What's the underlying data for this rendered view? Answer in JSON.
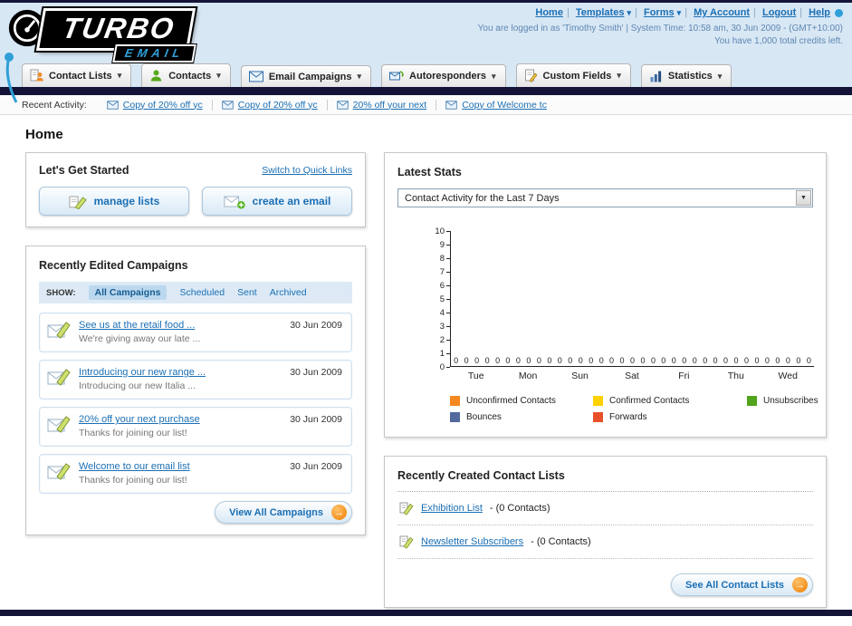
{
  "header": {
    "logo_text": "TURBO",
    "logo_sub": "EMAIL",
    "nav": [
      {
        "label": "Home"
      },
      {
        "label": "Templates"
      },
      {
        "label": "Forms"
      },
      {
        "label": "My Account"
      },
      {
        "label": "Logout"
      },
      {
        "label": "Help"
      }
    ],
    "login_info": "You are logged in as 'Timothy Smith' | System Time: 10:58 am, 30 Jun 2009 - (GMT+10:00)",
    "credits_info": "You have 1,000 total credits left."
  },
  "main_nav": {
    "items": [
      {
        "label": "Contact Lists"
      },
      {
        "label": "Contacts"
      },
      {
        "label": "Email Campaigns"
      },
      {
        "label": "Autoresponders"
      },
      {
        "label": "Custom Fields"
      },
      {
        "label": "Statistics"
      }
    ]
  },
  "recent_activity": {
    "label": "Recent Activity:",
    "items": [
      "Copy of 20% off yc",
      "Copy of 20% off yc",
      "20% off your next",
      "Copy of Welcome tc"
    ]
  },
  "page_title": "Home",
  "get_started": {
    "title": "Let's Get Started",
    "switch_link": "Switch to Quick Links",
    "manage_lists_label": "manage lists",
    "create_email_label": "create an email"
  },
  "campaigns": {
    "title": "Recently Edited Campaigns",
    "show_label": "SHOW:",
    "tabs": [
      "All Campaigns",
      "Scheduled",
      "Sent",
      "Archived"
    ],
    "selected_tab": "All Campaigns",
    "items": [
      {
        "title": "See us at the retail food ...",
        "subtitle": "We're giving away our late ...",
        "date": "30 Jun 2009"
      },
      {
        "title": "Introducing our new range ...",
        "subtitle": "Introducing our new Italia ...",
        "date": "30 Jun 2009"
      },
      {
        "title": "20% off your next purchase",
        "subtitle": "Thanks for joining our list!",
        "date": "30 Jun 2009"
      },
      {
        "title": "Welcome to our email list",
        "subtitle": "Thanks for joining our list!",
        "date": "30 Jun 2009"
      }
    ],
    "view_all_label": "View All Campaigns"
  },
  "latest_stats": {
    "title": "Latest Stats",
    "dropdown_value": "Contact Activity for the Last 7 Days"
  },
  "chart_data": {
    "type": "bar",
    "title": "Contact Activity for the Last 7 Days",
    "categories": [
      "Tue",
      "Mon",
      "Sun",
      "Sat",
      "Fri",
      "Thu",
      "Wed"
    ],
    "series": [
      {
        "name": "Unconfirmed Contacts",
        "color": "#f5871f",
        "values": [
          0,
          0,
          0,
          0,
          0,
          0,
          0
        ]
      },
      {
        "name": "Confirmed Contacts",
        "color": "#ffd200",
        "values": [
          0,
          0,
          0,
          0,
          0,
          0,
          0
        ]
      },
      {
        "name": "Unsubscribes",
        "color": "#52a41c",
        "values": [
          0,
          0,
          0,
          0,
          0,
          0,
          0
        ]
      },
      {
        "name": "Bounces",
        "color": "#52699e",
        "values": [
          0,
          0,
          0,
          0,
          0,
          0,
          0
        ]
      },
      {
        "name": "Forwards",
        "color": "#e8502a",
        "values": [
          0,
          0,
          0,
          0,
          0,
          0,
          0
        ]
      }
    ],
    "ylim": [
      0,
      10
    ],
    "yticks": [
      0,
      1,
      2,
      3,
      4,
      5,
      6,
      7,
      8,
      9,
      10
    ],
    "grid": false,
    "legend_position": "bottom"
  },
  "contact_lists": {
    "title": "Recently Created Contact Lists",
    "items": [
      {
        "name": "Exhibition List",
        "suffix": "- (0 Contacts)"
      },
      {
        "name": "Newsletter Subscribers",
        "suffix": "- (0 Contacts)"
      }
    ],
    "see_all_label": "See All Contact Lists"
  },
  "colors": {
    "accent_blue": "#1b6fb4",
    "dark_navy": "#141438",
    "header_blue": "#d8e7f4",
    "action_orange": "#f07f00"
  }
}
